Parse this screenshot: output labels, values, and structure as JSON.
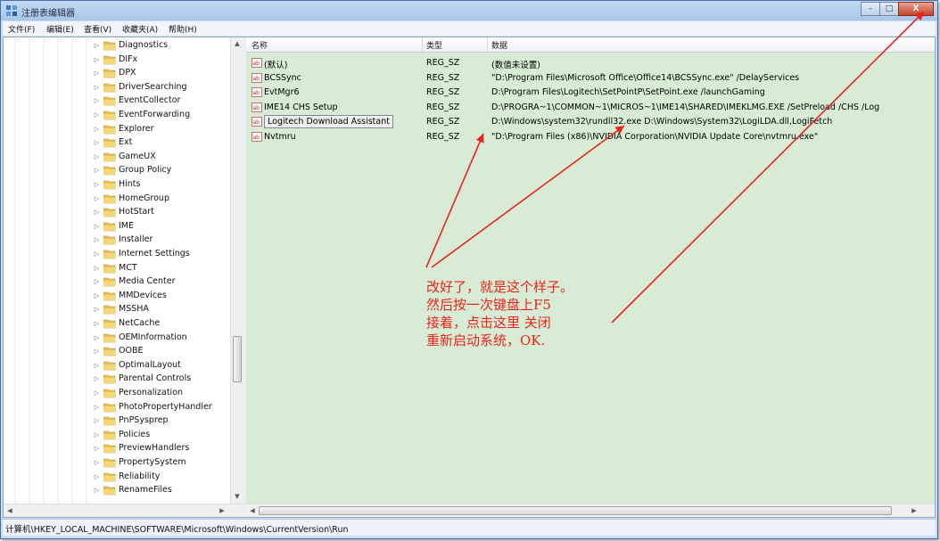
{
  "window": {
    "title": "注册表编辑器",
    "controls": {
      "minimize": "–",
      "maximize": "□",
      "close": "X"
    }
  },
  "menu": [
    "文件(F)",
    "编辑(E)",
    "查看(V)",
    "收藏夹(A)",
    "帮助(H)"
  ],
  "tree": {
    "items": [
      "Diagnostics",
      "DIFx",
      "DPX",
      "DriverSearching",
      "EventCollector",
      "EventForwarding",
      "Explorer",
      "Ext",
      "GameUX",
      "Group Policy",
      "Hints",
      "HomeGroup",
      "HotStart",
      "IME",
      "Installer",
      "Internet Settings",
      "MCT",
      "Media Center",
      "MMDevices",
      "MSSHA",
      "NetCache",
      "OEMInformation",
      "OOBE",
      "OptimalLayout",
      "Parental Controls",
      "Personalization",
      "PhotoPropertyHandler",
      "PnPSysprep",
      "Policies",
      "PreviewHandlers",
      "PropertySystem",
      "Reliability",
      "RenameFiles"
    ]
  },
  "values": {
    "headers": {
      "name": "名称",
      "type": "类型",
      "data": "数据"
    },
    "rows": [
      {
        "name": "(默认)",
        "type": "REG_SZ",
        "data": "(数值未设置)"
      },
      {
        "name": "BCSSync",
        "type": "REG_SZ",
        "data": "\"D:\\Program Files\\Microsoft Office\\Office14\\BCSSync.exe\" /DelayServices"
      },
      {
        "name": "EvtMgr6",
        "type": "REG_SZ",
        "data": "D:\\Program Files\\Logitech\\SetPointP\\SetPoint.exe /launchGaming"
      },
      {
        "name": "IME14 CHS Setup",
        "type": "REG_SZ",
        "data": "D:\\PROGRA~1\\COMMON~1\\MICROS~1\\IME14\\SHARED\\IMEKLMG.EXE /SetPreload /CHS /Log"
      },
      {
        "name": "Logitech Download Assistant",
        "type": "REG_SZ",
        "data": "D:\\Windows\\system32\\rundll32.exe D:\\Windows\\System32\\LogiLDA.dll,LogiFetch"
      },
      {
        "name": "Nvtmru",
        "type": "REG_SZ",
        "data": "\"D:\\Program Files (x86)\\NVIDIA Corporation\\NVIDIA Update Core\\nvtmru.exe\""
      }
    ]
  },
  "status": {
    "path": "计算机\\HKEY_LOCAL_MACHINE\\SOFTWARE\\Microsoft\\Windows\\CurrentVersion\\Run"
  },
  "annotation": {
    "lines": [
      "改好了，就是这个样子。",
      "然后按一次键盘上F5",
      "接着，点击这里 关闭",
      "重新启动系统，OK."
    ],
    "color": "#e8241c"
  },
  "colors": {
    "values_background": "#d8ecd5",
    "title_gradient_top": "#c3d9f2"
  }
}
